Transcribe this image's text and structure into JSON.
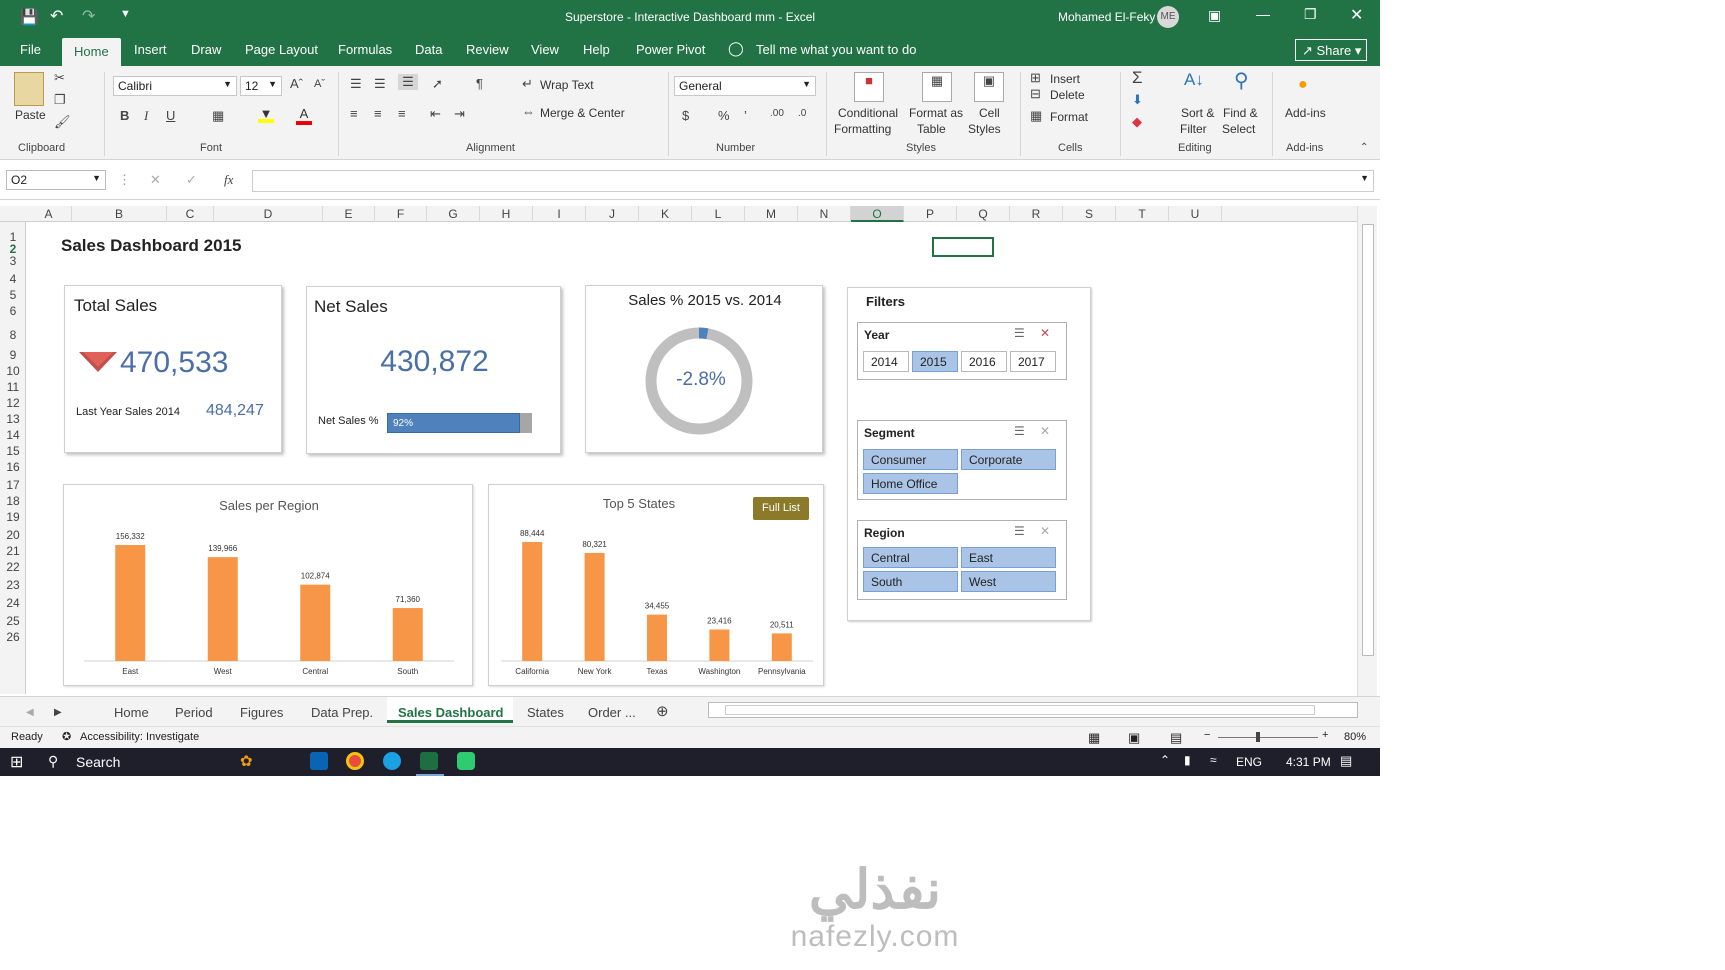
{
  "window": {
    "title": "Superstore - Interactive Dashboard  mm  -  Excel",
    "user": "Mohamed El-Feky",
    "user_initials": "ME"
  },
  "ribbon_tabs": [
    "File",
    "Home",
    "Insert",
    "Draw",
    "Page Layout",
    "Formulas",
    "Data",
    "Review",
    "View",
    "Help",
    "Power Pivot"
  ],
  "tell_me": "Tell me what you want to do",
  "share_label": "Share",
  "ribbon": {
    "paste": "Paste",
    "clipboard": "Clipboard",
    "font_name": "Calibri",
    "font_size": "12",
    "font_group": "Font",
    "wrap_text": "Wrap Text",
    "merge_center": "Merge & Center",
    "alignment": "Alignment",
    "number_format": "General",
    "number": "Number",
    "cond_fmt_1": "Conditional",
    "cond_fmt_2": "Formatting",
    "fmt_table_1": "Format as",
    "fmt_table_2": "Table",
    "cell_styles_1": "Cell",
    "cell_styles_2": "Styles",
    "styles": "Styles",
    "insert": "Insert",
    "delete": "Delete",
    "format": "Format",
    "cells": "Cells",
    "sort_1": "Sort &",
    "sort_2": "Filter",
    "find_1": "Find &",
    "find_2": "Select",
    "editing": "Editing",
    "addins": "Add-ins",
    "addins_group": "Add-ins"
  },
  "formula_bar": {
    "name_box": "O2",
    "fx": "fx",
    "value": ""
  },
  "columns": [
    "A",
    "B",
    "C",
    "D",
    "E",
    "F",
    "G",
    "H",
    "I",
    "J",
    "K",
    "L",
    "M",
    "N",
    "O",
    "P",
    "Q",
    "R",
    "S",
    "T",
    "U"
  ],
  "rows": [
    "1",
    "2",
    "3",
    "4",
    "5",
    "6",
    "8",
    "9",
    "10",
    "11",
    "12",
    "13",
    "14",
    "15",
    "16",
    "17",
    "18",
    "19",
    "20",
    "21",
    "22",
    "23",
    "24",
    "25",
    "26"
  ],
  "dashboard": {
    "title": "Sales Dashboard 2015",
    "total_sales": {
      "title": "Total Sales",
      "value": "470,533",
      "last_year_label": "Last Year Sales 2014",
      "last_year_value": "484,247"
    },
    "net_sales": {
      "title": "Net Sales",
      "value": "430,872",
      "pct_label": "Net Sales %",
      "pct_text": "92%",
      "pct": 0.92
    },
    "sales_pct": {
      "title": "Sales % 2015 vs. 2014",
      "value": "-2.8%",
      "ratio": 0.028
    },
    "filters": {
      "title": "Filters",
      "year": {
        "label": "Year",
        "options": [
          "2014",
          "2015",
          "2016",
          "2017"
        ],
        "selected": "2015"
      },
      "segment": {
        "label": "Segment",
        "options": [
          "Consumer",
          "Corporate",
          "Home Office"
        ]
      },
      "region": {
        "label": "Region",
        "options": [
          "Central",
          "East",
          "South",
          "West"
        ]
      }
    },
    "full_list": "Full List"
  },
  "chart_data": [
    {
      "type": "bar",
      "title": "Sales per Region",
      "categories": [
        "East",
        "West",
        "Central",
        "South"
      ],
      "values": [
        156332,
        139966,
        102874,
        71360
      ],
      "labels": [
        "156,332",
        "139,966",
        "102,874",
        "71,360"
      ],
      "color": "#f79646"
    },
    {
      "type": "bar",
      "title": "Top 5 States",
      "categories": [
        "California",
        "New York",
        "Texas",
        "Washington",
        "Pennsylvania"
      ],
      "values": [
        88444,
        80321,
        34455,
        23416,
        20511
      ],
      "labels": [
        "88,444",
        "80,321",
        "34,455",
        "23,416",
        "20,511"
      ],
      "color": "#f79646"
    }
  ],
  "sheet_tabs": [
    "Home",
    "Period",
    "Figures",
    "Data Prep.",
    "Sales Dashboard",
    "States",
    "Order ..."
  ],
  "active_sheet": "Sales Dashboard",
  "status": {
    "ready": "Ready",
    "accessibility": "Accessibility: Investigate",
    "zoom": "80%"
  },
  "taskbar": {
    "search": "Search",
    "lang": "ENG",
    "time": "4:31 PM"
  },
  "watermark": {
    "arabic": "نفذلي",
    "latin": "nafezly.com"
  }
}
